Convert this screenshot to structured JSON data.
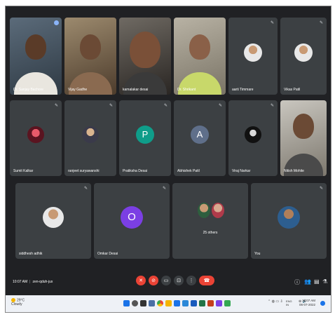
{
  "participants_row1": [
    {
      "name": "Dr. Sanjay Bachore",
      "video": true
    },
    {
      "name": "Vijay Gadhe",
      "video": true
    },
    {
      "name": "kamalakar desai",
      "video": true
    },
    {
      "name": "Dr. Shrikant",
      "video": true
    },
    {
      "name": "aarti Timmare",
      "video": false
    },
    {
      "name": "Vikas Patil",
      "video": false
    }
  ],
  "participants_row2": [
    {
      "name": "Sumit Kalkar",
      "initial": ""
    },
    {
      "name": "ranjeet suryawanshi",
      "initial": ""
    },
    {
      "name": "Pratiksha Desai",
      "initial": "P",
      "color": "#0f9d8a"
    },
    {
      "name": "Abhishek Patil",
      "initial": "A",
      "color": "#5f6f8a"
    },
    {
      "name": "Viraj Narkar",
      "initial": ""
    },
    {
      "name": "Nitish Mohite",
      "initial": ""
    }
  ],
  "participants_row3": [
    {
      "name": "siddhesh adhik",
      "initial": ""
    },
    {
      "name": "Omkar Desai",
      "initial": "O",
      "color": "#7b3fe4"
    },
    {
      "name": "25 others",
      "initial": ""
    },
    {
      "name": "You",
      "initial": ""
    }
  ],
  "meeting": {
    "time": "10:07 AM",
    "code": "zen-qduh-jux"
  },
  "controls": [
    "mic-off",
    "camera-off",
    "captions",
    "present",
    "more",
    "end-call"
  ],
  "right_controls": [
    "info",
    "people",
    "chat",
    "activities"
  ],
  "taskbar": {
    "weather_temp": "29°C",
    "weather_desc": "Cloudy",
    "lang": "ENG",
    "region": "IN",
    "clock_time": "10:07 AM",
    "clock_date": "06-07-2022"
  },
  "colors": {
    "background": "#202124",
    "tile": "#3c4043",
    "danger": "#ea4335",
    "accent": "#8ab4f8"
  }
}
